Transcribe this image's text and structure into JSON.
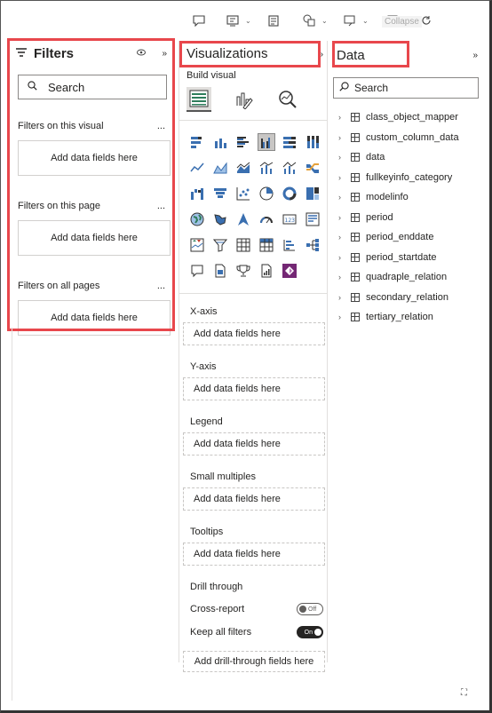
{
  "toolbar": {
    "icons": [
      "comment-icon",
      "visual-icon",
      "note-icon",
      "shapes-icon",
      "bookmark-icon",
      "collapse-icon",
      "refresh-icon"
    ],
    "tooltip": "Collapse"
  },
  "filters": {
    "title": "Filters",
    "search_placeholder": "Search",
    "sections": [
      {
        "title": "Filters on this visual",
        "well": "Add data fields here"
      },
      {
        "title": "Filters on this page",
        "well": "Add data fields here"
      },
      {
        "title": "Filters on all pages",
        "well": "Add data fields here"
      }
    ],
    "more": "..."
  },
  "visualizations": {
    "title": "Visualizations",
    "build_visual": "Build visual",
    "wells": [
      {
        "label": "X-axis",
        "placeholder": "Add data fields here"
      },
      {
        "label": "Y-axis",
        "placeholder": "Add data fields here"
      },
      {
        "label": "Legend",
        "placeholder": "Add data fields here"
      },
      {
        "label": "Small multiples",
        "placeholder": "Add data fields here"
      },
      {
        "label": "Tooltips",
        "placeholder": "Add data fields here"
      }
    ],
    "drill_through": "Drill through",
    "cross_report": {
      "label": "Cross-report",
      "state": "Off"
    },
    "keep_all_filters": {
      "label": "Keep all filters",
      "state": "On"
    },
    "drill_button": "Add drill-through fields here"
  },
  "data": {
    "title": "Data",
    "search_placeholder": "Search",
    "items": [
      "class_object_mapper",
      "custom_column_data",
      "data",
      "fullkeyinfo_category",
      "modelinfo",
      "period",
      "period_enddate",
      "period_startdate",
      "quadraple_relation",
      "secondary_relation",
      "tertiary_relation"
    ]
  },
  "colors": {
    "highlight": "#e8474c",
    "accent": "#c8c6c4"
  }
}
